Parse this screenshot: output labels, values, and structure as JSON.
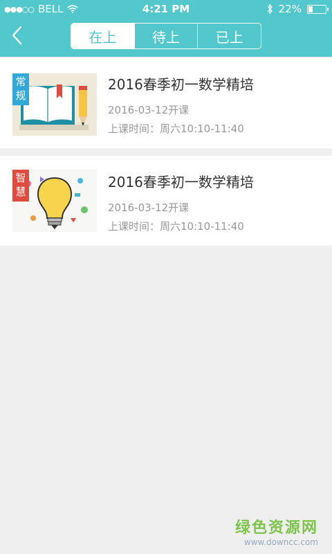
{
  "status_bar": {
    "carrier": "BELL",
    "time": "4:21 PM",
    "battery_pct": "22%",
    "battery_level": 0.22
  },
  "header": {
    "back_icon": "chevron-left-icon",
    "tabs": [
      {
        "label": "在上",
        "active": true
      },
      {
        "label": "待上",
        "active": false
      },
      {
        "label": "已上",
        "active": false
      }
    ],
    "accent": "#52c7cc"
  },
  "courses": [
    {
      "badge": "常规",
      "badge_color": "#31a8d8",
      "title": "2016春季初一数学精培",
      "start": "2016-03-12开课",
      "schedule": "上课时间：周六10:10-11:40"
    },
    {
      "badge": "智慧",
      "badge_color": "#e04b3f",
      "title": "2016春季初一数学精培",
      "start": "2016-03-12开课",
      "schedule": "上课时间：周六10:10-11:40"
    }
  ],
  "watermark": {
    "title": "绿色资源网",
    "url": "www.downcc.com"
  }
}
